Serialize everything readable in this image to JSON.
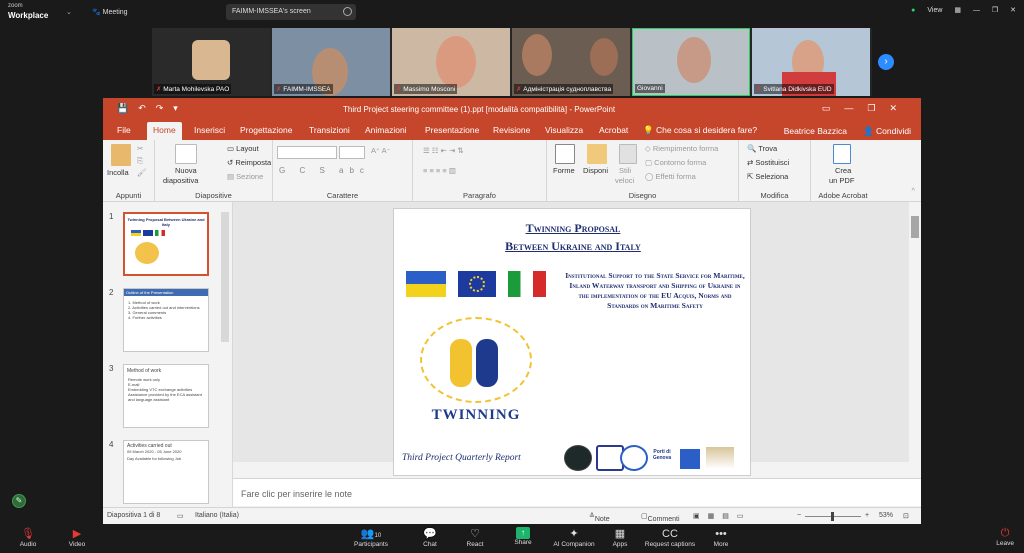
{
  "zoom": {
    "logo_top": "zoom",
    "logo_bottom": "Workplace",
    "meeting_label": "Meeting",
    "share_title": "FAIMM-IMSSEA's screen",
    "view_label": "View",
    "next_icon": "chevron-right-icon",
    "participants": [
      {
        "name": "Marta Mohilevska PAO"
      },
      {
        "name": "FAIMM-IMSSEA"
      },
      {
        "name": "Massimo Mosconi"
      },
      {
        "name": "Адміністрація судноплавства"
      },
      {
        "name": "Giovanni"
      },
      {
        "name": "Svitlana Didkivska EUD"
      }
    ],
    "controls": {
      "audio": "Audio",
      "video": "Video",
      "participants": "Participants",
      "participants_count": "10",
      "chat": "Chat",
      "react": "React",
      "share": "Share",
      "ai": "AI Companion",
      "apps": "Apps",
      "captions": "Request captions",
      "more": "More",
      "leave": "Leave"
    }
  },
  "powerpoint": {
    "title": "Third Project steering committee (1).ppt [modalità compatibilità] - PowerPoint",
    "tabs": [
      "File",
      "Home",
      "Inserisci",
      "Progettazione",
      "Transizioni",
      "Animazioni",
      "Presentazione",
      "Revisione",
      "Visualizza",
      "Acrobat"
    ],
    "tell_me": "Che cosa si desidera fare?",
    "user": "Beatrice Bazzica",
    "share": "Condividi",
    "ribbon": {
      "incolla": "Incolla",
      "appunti": "Appunti",
      "nuova": "Nuova",
      "diapositiva_btn": "diapositiva",
      "layout": "Layout",
      "reimposta": "Reimposta",
      "sezione": "Sezione",
      "diapositive": "Diapositive",
      "carattere": "Carattere",
      "font_buttons": "G C S abc",
      "paragrafo": "Paragrafo",
      "forme": "Forme",
      "disponi": "Disponi",
      "stili": "Stili",
      "veloci": "veloci",
      "riempimento": "Riempimento forma",
      "contorno": "Contorno forma",
      "effetti": "Effetti forma",
      "disegno": "Disegno",
      "trova": "Trova",
      "sostituisci": "Sostituisci",
      "seleziona": "Seleziona",
      "modifica": "Modifica",
      "crea": "Crea",
      "un_pdf": "un PDF",
      "adobe": "Adobe Acrobat"
    },
    "slides": [
      {
        "num": "1",
        "title": "Twinning Proposal Between Ukraine and Italy"
      },
      {
        "num": "2",
        "title": "Outline of the Presentation",
        "items": [
          "1. Method of work",
          "2. Activities carried out and interventions",
          "3. General comments",
          "4. Further activities"
        ]
      },
      {
        "num": "3",
        "title": "Method of work",
        "items": [
          "Remote work only",
          "E-mail",
          "Embedding VTC exchange activities",
          "Assistance provided by the ECA assistant and language assistant"
        ]
      },
      {
        "num": "4",
        "title": "Activities carried out",
        "subtitle": "05 March 2020 - 05 June 2020",
        "items": [
          "Day Available for following Job"
        ]
      }
    ],
    "main_slide": {
      "title_line1": "Twinning Proposal",
      "title_line2": "Between Ukraine and Italy",
      "institutional": "Institutional Support to the State Service for Maritime, Inland Waterway transport and Shipping of Ukraine in the implementation of the EU Acquis, Norms and Standards on Maritime Safety",
      "twinning": "TWINNING",
      "footer": "Third Project Quarterly Report",
      "logo_labels": [
        "Porti di Genova"
      ]
    },
    "notes_placeholder": "Fare clic per inserire le note",
    "status": {
      "slide_info": "Diapositiva 1 di 8",
      "language": "Italiano (Italia)",
      "note": "Note",
      "commenti": "Commenti",
      "zoom": "53%"
    }
  },
  "colors": {
    "ppt_accent": "#c6462b",
    "zoom_blue": "#2d8cff"
  }
}
